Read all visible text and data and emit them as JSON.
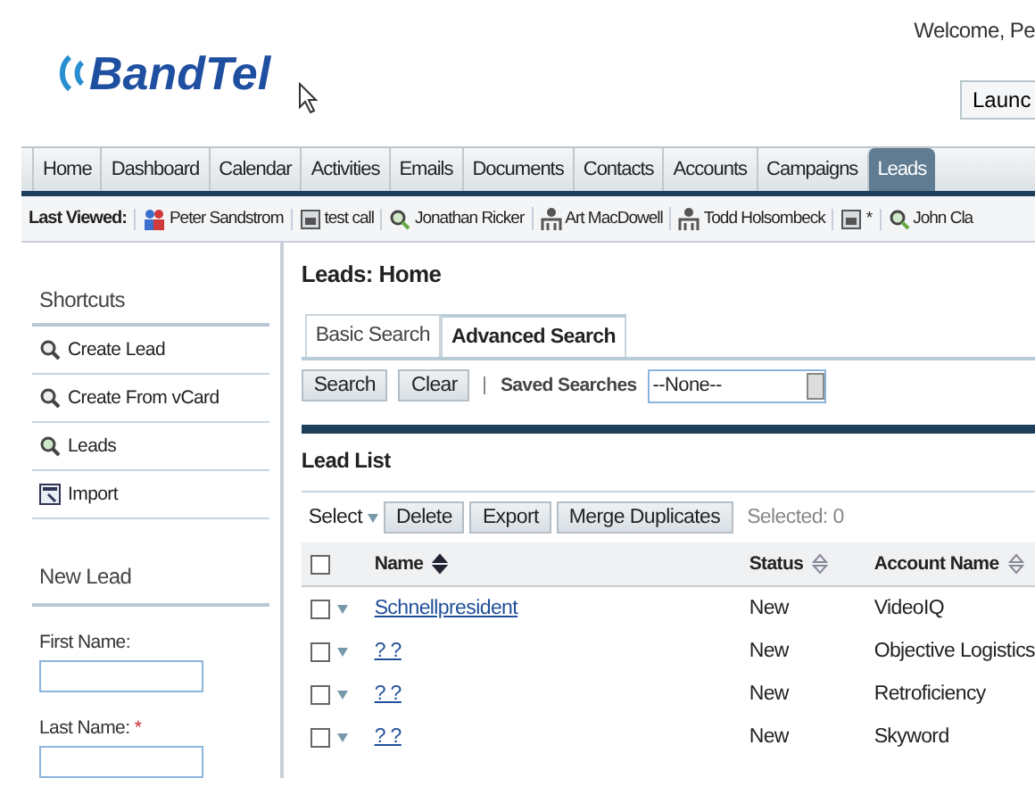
{
  "header": {
    "logo": "BandTel",
    "welcome": "Welcome, Pe",
    "launch_button": "Launc"
  },
  "nav_tabs": [
    {
      "label": "Home",
      "selected": false
    },
    {
      "label": "Dashboard",
      "selected": false
    },
    {
      "label": "Calendar",
      "selected": false
    },
    {
      "label": "Activities",
      "selected": false
    },
    {
      "label": "Emails",
      "selected": false
    },
    {
      "label": "Documents",
      "selected": false
    },
    {
      "label": "Contacts",
      "selected": false
    },
    {
      "label": "Accounts",
      "selected": false
    },
    {
      "label": "Campaigns",
      "selected": false
    },
    {
      "label": "Leads",
      "selected": true
    }
  ],
  "last_viewed": {
    "label": "Last Viewed:",
    "items": [
      {
        "kind": "contact",
        "label": "Peter Sandstrom"
      },
      {
        "kind": "call",
        "label": "test call"
      },
      {
        "kind": "lead",
        "label": "Jonathan Ricker"
      },
      {
        "kind": "account",
        "label": "Art MacDowell"
      },
      {
        "kind": "account",
        "label": "Todd Holsombeck"
      },
      {
        "kind": "call",
        "label": "*"
      },
      {
        "kind": "lead",
        "label": "John Cla"
      }
    ]
  },
  "sidebar": {
    "shortcuts_title": "Shortcuts",
    "shortcuts": [
      {
        "kind": "create",
        "label": "Create Lead"
      },
      {
        "kind": "create",
        "label": "Create From vCard"
      },
      {
        "kind": "lead",
        "label": "Leads"
      },
      {
        "kind": "import",
        "label": "Import"
      }
    ],
    "form_title": "New Lead",
    "fields": [
      {
        "label": "First Name:"
      },
      {
        "label": "Last Name:",
        "mark": "*"
      }
    ]
  },
  "main": {
    "title": "Leads: Home",
    "search_tabs": [
      {
        "label": "Basic Search",
        "selected": false
      },
      {
        "label": "Advanced Search",
        "selected": true
      }
    ],
    "search_button": "Search",
    "clear_button": "Clear",
    "saved_searches_label": "Saved Searches",
    "saved_searches_value": "--None--",
    "list_title": "Lead List",
    "select_label": "Select",
    "actions": [
      "Delete",
      "Export",
      "Merge Duplicates"
    ],
    "selected_count": "Selected:  0",
    "all_checked": false,
    "columns": [
      {
        "label": "Name",
        "sorted": true
      },
      {
        "label": "Status",
        "sorted": false
      },
      {
        "label": "Account Name",
        "sorted": false
      }
    ],
    "rows": [
      {
        "checked": false,
        "name": "Schnellpresident",
        "status": "New",
        "account": "VideoIQ"
      },
      {
        "checked": false,
        "name": "? ?",
        "status": "New",
        "account": "Objective Logistics"
      },
      {
        "checked": false,
        "name": "? ?",
        "status": "New",
        "account": "Retroficiency"
      },
      {
        "checked": false,
        "name": "? ?",
        "status": "New",
        "account": "Skyword"
      }
    ]
  }
}
